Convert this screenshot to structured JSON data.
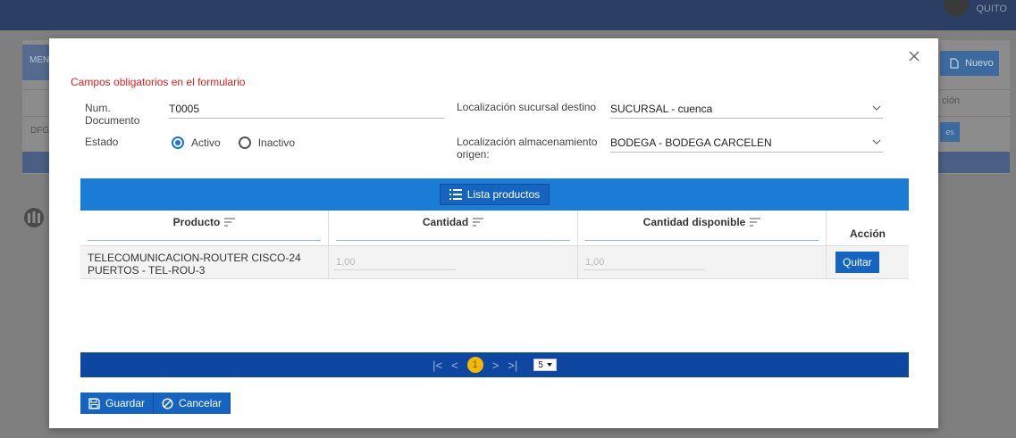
{
  "background": {
    "user_name": "QUITO",
    "menu_tab": "MEN",
    "nuevo_label": "Nuevo",
    "col_label": "ción",
    "row_label": "DFG",
    "strip_label": "es"
  },
  "modal": {
    "required_note": "Campos obligatorios en el formulario",
    "num_documento_label": "Num. Documento",
    "num_documento_value": "T0005",
    "estado_label": "Estado",
    "estado_options": [
      "Activo",
      "Inactivo"
    ],
    "estado_selected": "Activo",
    "sucursal_label": "Localización sucursal destino",
    "sucursal_value": "SUCURSAL - cuenca",
    "almacen_label": "Localización almacenamiento origen:",
    "almacen_value": "BODEGA - BODEGA CARCELEN"
  },
  "table": {
    "toolbar_button": "Lista productos",
    "columns": [
      "Producto",
      "Cantidad",
      "Cantidad disponible",
      "Acción"
    ],
    "rows": [
      {
        "producto": "TELECOMUNICACION-ROUTER CISCO-24 PUERTOS - TEL-ROU-3",
        "cantidad": "1,00",
        "disponible": "1,00",
        "accion": "Quitar"
      }
    ]
  },
  "pager": {
    "first": "|<",
    "prev": "<",
    "current_page": "1",
    "next": ">",
    "last": ">|",
    "page_size": "5"
  },
  "footer": {
    "save_label": "Guardar",
    "cancel_label": "Cancelar"
  },
  "colors": {
    "accent": "#1b7cd6",
    "pager_bg": "#0d47a1",
    "required": "#e02020",
    "current_page": "#f5b800"
  }
}
